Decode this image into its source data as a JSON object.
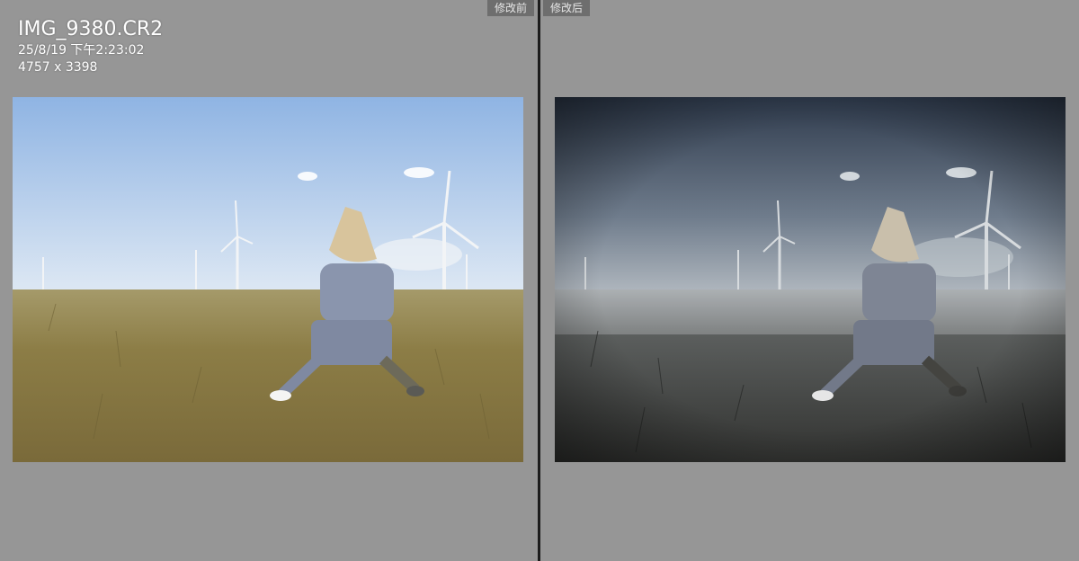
{
  "file": {
    "name": "IMG_9380.CR2",
    "datetime": "25/8/19 下午2:23:02",
    "dimensions": "4757 x 3398"
  },
  "panes": {
    "before": {
      "label": "修改前"
    },
    "after": {
      "label": "修改后"
    }
  },
  "colors": {
    "before_sky_top": "#8fb4e3",
    "before_sky_bottom": "#d8e6f4",
    "before_grass": "#8e7f45",
    "after_sky_top": "#2f3b4d",
    "after_sky_bottom": "#9aa3ad",
    "after_grass": "#3e3f3d"
  }
}
